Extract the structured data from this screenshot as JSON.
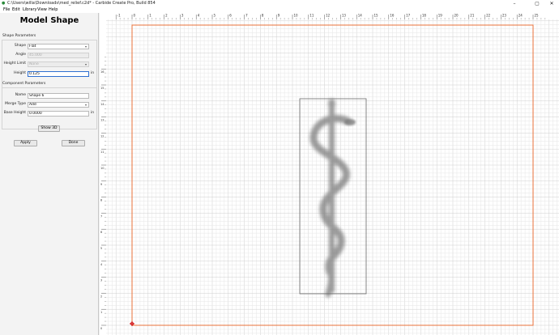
{
  "window": {
    "title": "C:\\Users\\willa\\Downloads\\med_relief.c2d* - Carbide Create Pro, Build 854",
    "min_glyph": "–",
    "max_glyph": "▢",
    "close_glyph": "✕"
  },
  "menu": [
    "File",
    "Edit",
    "Library",
    "View",
    "Help"
  ],
  "panel": {
    "heading": "Model Shape",
    "shape_params": {
      "title": "Shape Parameters",
      "shape_label": "Shape",
      "shape_value": "Flat",
      "angle_label": "Angle",
      "angle_value": "45.000",
      "height_limit_label": "Height Limit",
      "height_limit_value": "None",
      "height_label": "Height",
      "height_value": "0.125",
      "height_unit": "in"
    },
    "component_params": {
      "title": "Component Parameters",
      "name_label": "Name",
      "name_value": "Shape 6",
      "merge_label": "Merge Type",
      "merge_value": "Add",
      "base_label": "Base Height",
      "base_value": "0.0000",
      "base_unit": "in"
    },
    "show3d_label": "Show 3D",
    "apply_label": "Apply",
    "done_label": "Done"
  },
  "ruler": {
    "top_labels": [
      "-1",
      "0",
      "1",
      "2",
      "3",
      "4",
      "5",
      "6",
      "7",
      "8",
      "9",
      "10",
      "11",
      "12",
      "13",
      "14",
      "15",
      "16",
      "17",
      "18",
      "19",
      "20",
      "21",
      "22",
      "23",
      "24",
      "25"
    ],
    "left_labels": [
      "16",
      "15",
      "14",
      "13",
      "12",
      "11",
      "10",
      "9",
      "8",
      "7",
      "6",
      "5",
      "4",
      "3",
      "2",
      "1",
      "0"
    ]
  },
  "colors": {
    "board_outline": "#e8703a",
    "grid_minor": "#e6e6e6",
    "grid_major": "#cfcfcf",
    "selection_box": "#6a6a6a",
    "relief": "#7a7a7a"
  },
  "icons": {
    "app": "carbide-create-icon",
    "origin": "origin-marker-icon"
  }
}
